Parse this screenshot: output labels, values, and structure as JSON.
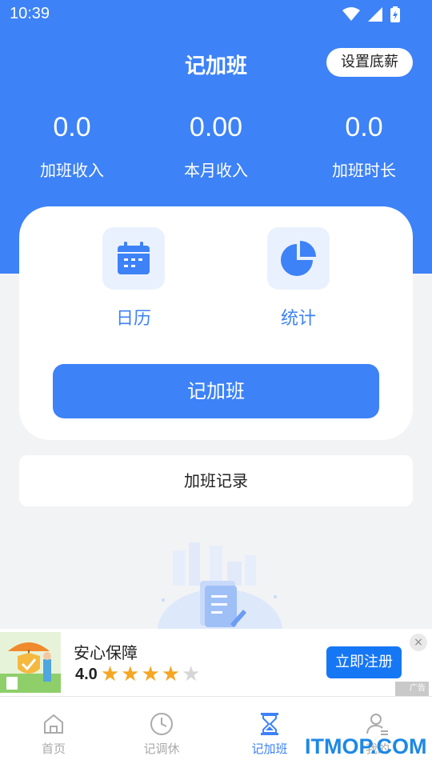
{
  "status_bar": {
    "time": "10:39"
  },
  "header": {
    "title": "记加班",
    "settings_button": "设置底薪",
    "color": "#3d82f7"
  },
  "stats": [
    {
      "value": "0.0",
      "label": "加班收入"
    },
    {
      "value": "0.00",
      "label": "本月收入"
    },
    {
      "value": "0.0",
      "label": "加班时长"
    }
  ],
  "actions": {
    "calendar_label": "日历",
    "statistics_label": "统计",
    "primary_button": "记加班"
  },
  "records": {
    "label": "加班记录"
  },
  "ad": {
    "title": "安心保障",
    "rating": "4.0",
    "stars_filled": 4,
    "stars_total": 5,
    "cta": "立即注册",
    "tag": "广告",
    "close": "×"
  },
  "tabbar": {
    "items": [
      {
        "label": "首页",
        "icon": "home-icon",
        "active": false
      },
      {
        "label": "记调休",
        "icon": "clock-icon",
        "active": false
      },
      {
        "label": "记加班",
        "icon": "hourglass-icon",
        "active": true
      },
      {
        "label": "我的",
        "icon": "user-icon",
        "active": false
      }
    ]
  },
  "watermark": "ITMOP.COM"
}
